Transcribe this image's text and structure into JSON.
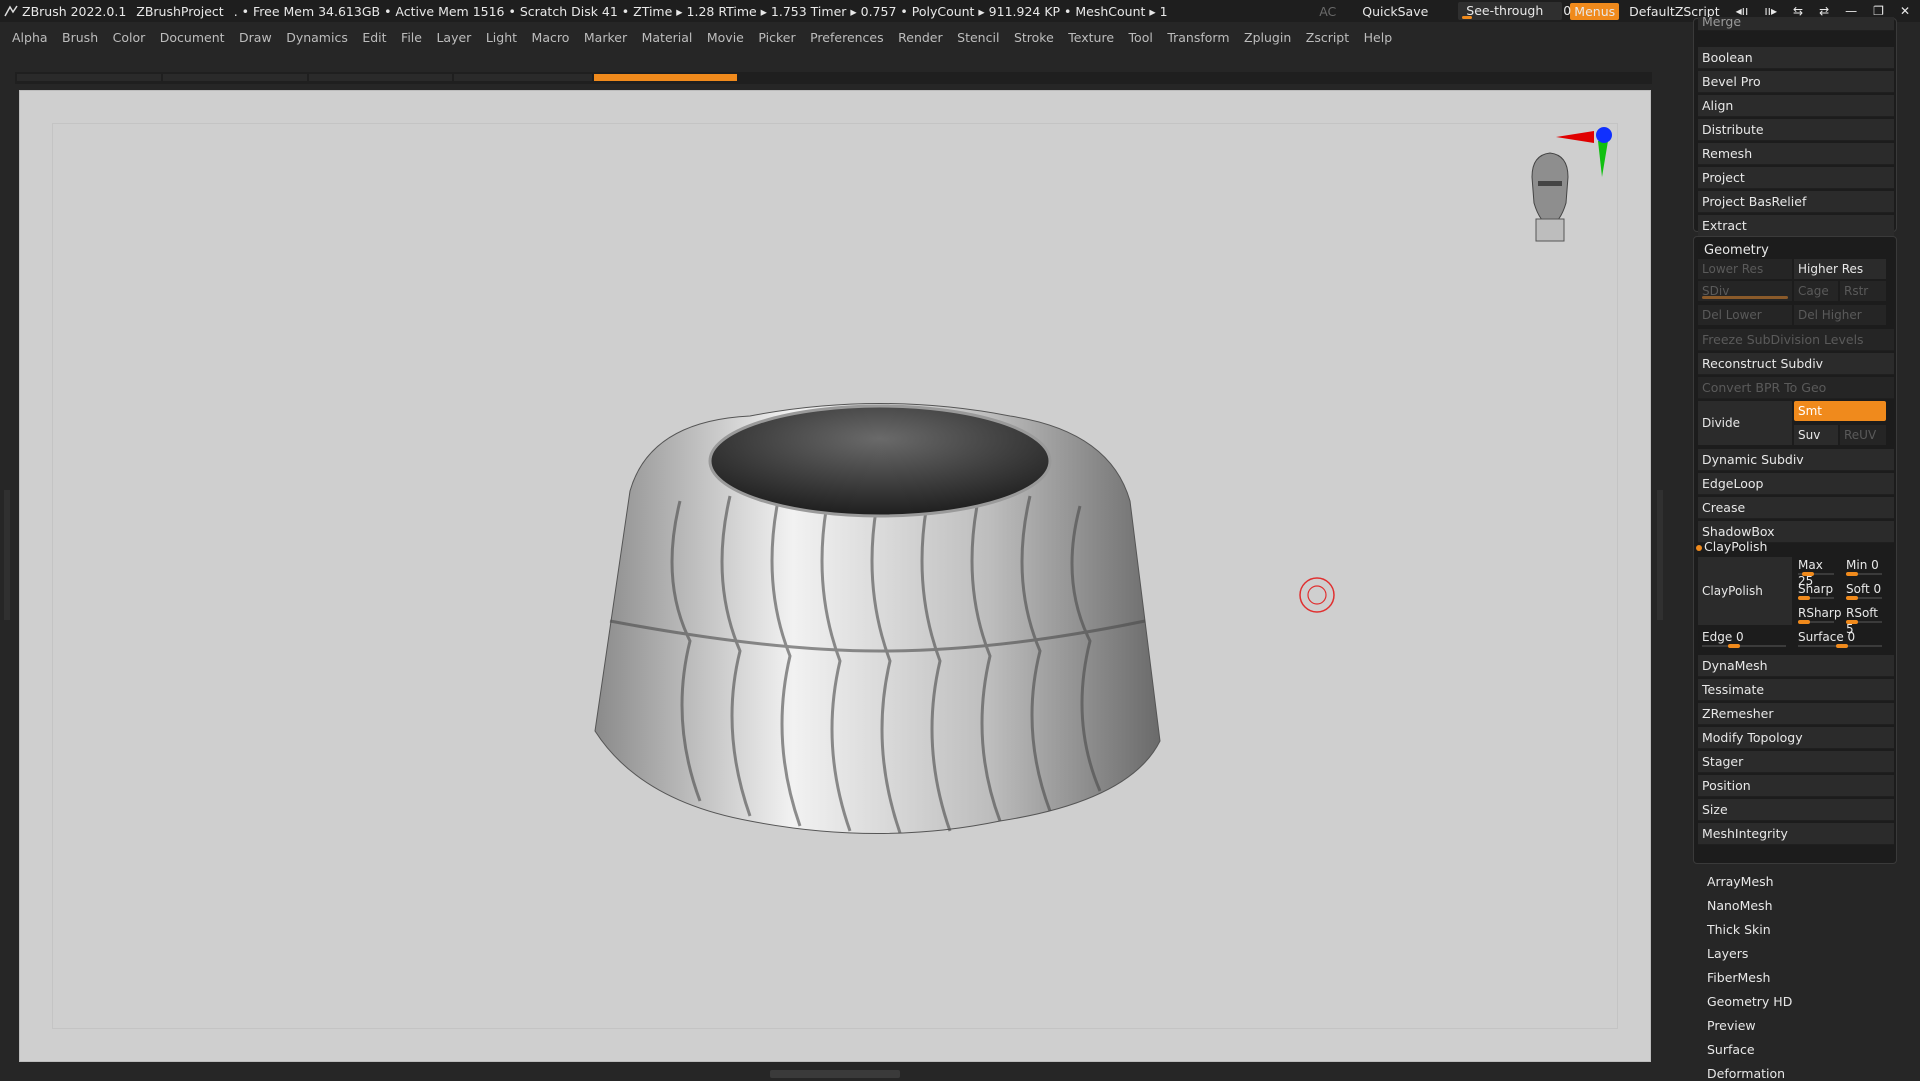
{
  "titlebar": {
    "app": "ZBrush 2022.0.1",
    "project": "ZBrushProject",
    "stats": ". • Free Mem 34.613GB • Active Mem 1516 • Scratch Disk 41 • ZTime ▸ 1.28 RTime ▸ 1.753 Timer ▸ 0.757 • PolyCount ▸ 911.924 KP • MeshCount ▸ 1",
    "ac": "AC",
    "quicksave": "QuickSave",
    "see_through_label": "See-through",
    "see_through_value": "0",
    "menus": "Menus",
    "default_zscript": "DefaultZScript"
  },
  "menubar": [
    "Alpha",
    "Brush",
    "Color",
    "Document",
    "Draw",
    "Dynamics",
    "Edit",
    "File",
    "Layer",
    "Light",
    "Macro",
    "Marker",
    "Material",
    "Movie",
    "Picker",
    "Preferences",
    "Render",
    "Stencil",
    "Stroke",
    "Texture",
    "Tool",
    "Transform",
    "Zplugin",
    "Zscript",
    "Help"
  ],
  "subtool_menu": [
    "Merge",
    "Boolean",
    "Bevel Pro",
    "Align",
    "Distribute",
    "Remesh",
    "Project",
    "Project BasRelief",
    "Extract"
  ],
  "geometry": {
    "title": "Geometry",
    "lower_res": "Lower Res",
    "higher_res": "Higher Res",
    "sdiv": "SDiv",
    "cage": "Cage",
    "rstr": "Rstr",
    "del_lower": "Del Lower",
    "del_higher": "Del Higher",
    "freeze": "Freeze SubDivision Levels",
    "reconstruct": "Reconstruct Subdiv",
    "convert": "Convert BPR To Geo",
    "divide": "Divide",
    "smt": "Smt",
    "suv": "Suv",
    "reuv": "ReUV",
    "items": [
      "Dynamic Subdiv",
      "EdgeLoop",
      "Crease",
      "ShadowBox"
    ],
    "claypolish_header": "ClayPolish",
    "claypolish_btn": "ClayPolish",
    "max": "Max 25",
    "min": "Min 0",
    "sharp": "Sharp",
    "soft": "Soft 0",
    "rsharp": "RSharp",
    "rsoft": "RSoft 5",
    "edge": "Edge 0",
    "surface": "Surface 0",
    "items2": [
      "DynaMesh",
      "Tessimate",
      "ZRemesher",
      "Modify Topology",
      "Stager",
      "Position",
      "Size",
      "MeshIntegrity"
    ]
  },
  "tool_subpalettes": [
    "ArrayMesh",
    "NanoMesh",
    "Thick Skin",
    "Layers",
    "FiberMesh",
    "Geometry HD",
    "Preview",
    "Surface",
    "Deformation"
  ],
  "colors": {
    "accent": "#f08a1c",
    "viewport_bg": "#cfcfcf",
    "panel_bg": "#262626"
  }
}
